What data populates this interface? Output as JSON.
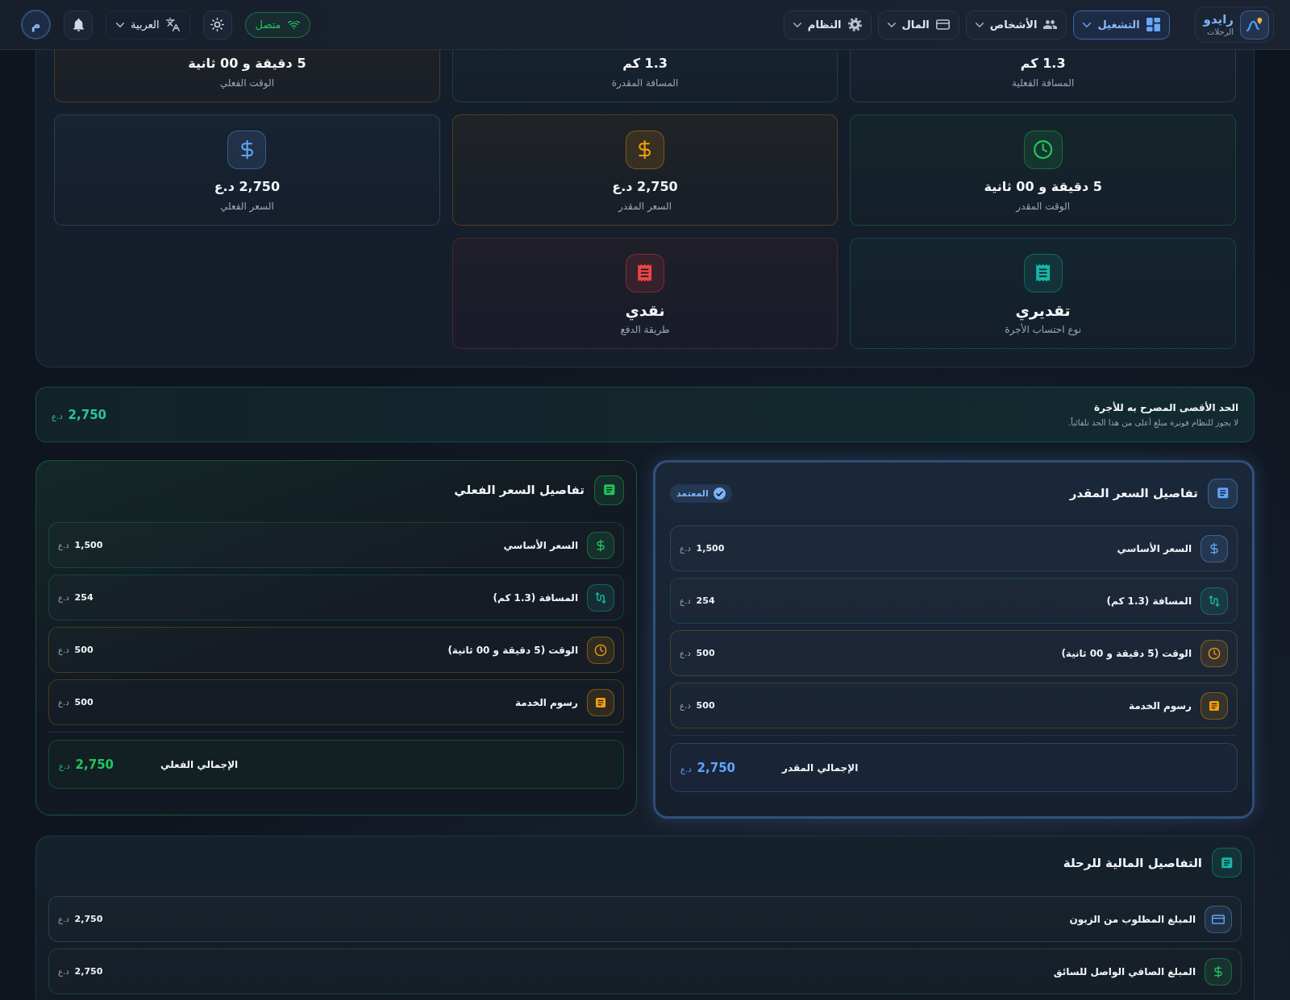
{
  "top_bar": {
    "logo": {
      "title": "رايدو",
      "subtitle": "الرحلات"
    },
    "nav": [
      {
        "label": "التشغيل",
        "selected": true
      },
      {
        "label": "الأشخاص",
        "selected": false
      },
      {
        "label": "المال",
        "selected": false
      },
      {
        "label": "النظام",
        "selected": false
      }
    ],
    "connection": {
      "label": "متصل"
    },
    "language": {
      "label": "العربية"
    },
    "avatar": {
      "initial": "م"
    }
  },
  "trip_stats": [
    {
      "kind": "clipped",
      "value": "1.3 كم",
      "label": "المسافة الفعلية",
      "color": "#2b3b52"
    },
    {
      "kind": "clipped",
      "value": "1.3 كم",
      "label": "المسافة المقدرة",
      "color": "#1d4045"
    },
    {
      "kind": "clipped",
      "value": "5 دقيقة و 00 ثانية",
      "label": "الوقت الفعلي",
      "color": "#4a3b24"
    },
    {
      "kind": "time",
      "value": "5 دقيقة و 00 ثانية",
      "label": "الوقت المقدر",
      "color": "#22c55e"
    },
    {
      "kind": "price",
      "value": "2,750 د.ع",
      "label": "السعر المقدر",
      "color": "#f59e0b"
    },
    {
      "kind": "price",
      "value": "2,750 د.ع",
      "label": "السعر الفعلي",
      "color": "#60a5fa"
    },
    {
      "kind": "label",
      "value": "تقديري",
      "label": "نوع احتساب الأجرة",
      "color": "#14b8a6"
    },
    {
      "kind": "label",
      "value": "نقدي",
      "label": "طريقة الدفع",
      "color": "#ef4444"
    }
  ],
  "max_fare": {
    "title": "الحد الأقصى المصرح به للأجرة",
    "note": "لا يجوز للنظام فوترة مبلغ أعلى من هذا الحد تلقائياً.",
    "amount": "2,750",
    "currency": "د.ع"
  },
  "price_panels": [
    {
      "title": "تفاصيل السعر المقدر",
      "selected": true,
      "color": "#60a5fa",
      "badge": "المعتمد",
      "rows": [
        {
          "kind": "base",
          "label": "السعر الأساسي",
          "amount": "1,500",
          "currency": "د.ع",
          "color": "#60a5fa"
        },
        {
          "kind": "distance",
          "label": "المسافة (1.3 كم)",
          "amount": "254",
          "currency": "د.ع",
          "color": "#14b8a6"
        },
        {
          "kind": "time",
          "label": "الوقت (5 دقيقة و 00 ثانية)",
          "amount": "500",
          "currency": "د.ع",
          "color": "#f59e0b"
        },
        {
          "kind": "fee",
          "label": "رسوم الخدمة",
          "amount": "500",
          "currency": "د.ع",
          "color": "#f59e0b"
        }
      ],
      "total": {
        "label": "الإجمالي المقدر",
        "amount": "2,750",
        "currency": "د.ع"
      }
    },
    {
      "title": "تفاصيل السعر الفعلي",
      "selected": false,
      "color": "#22c55e",
      "rows": [
        {
          "kind": "base",
          "label": "السعر الأساسي",
          "amount": "1,500",
          "currency": "د.ع",
          "color": "#22c55e"
        },
        {
          "kind": "distance",
          "label": "المسافة (1.3 كم)",
          "amount": "254",
          "currency": "د.ع",
          "color": "#14b8a6"
        },
        {
          "kind": "time",
          "label": "الوقت (5 دقيقة و 00 ثانية)",
          "amount": "500",
          "currency": "د.ع",
          "color": "#f59e0b"
        },
        {
          "kind": "fee",
          "label": "رسوم الخدمة",
          "amount": "500",
          "currency": "د.ع",
          "color": "#f59e0b"
        }
      ],
      "total": {
        "label": "الإجمالي الفعلي",
        "amount": "2,750",
        "currency": "د.ع"
      }
    }
  ],
  "financial_details": {
    "title": "التفاصيل المالية للرحلة",
    "rows": [
      {
        "kind": "charge",
        "label": "المبلغ المطلوب من الزبون",
        "amount": "2,750",
        "currency": "د.ع",
        "color": "#60a5fa"
      },
      {
        "kind": "payout",
        "label": "المبلغ الصافي الواصل للسائق",
        "amount": "2,750",
        "currency": "د.ع",
        "color": "#22c55e"
      }
    ]
  }
}
